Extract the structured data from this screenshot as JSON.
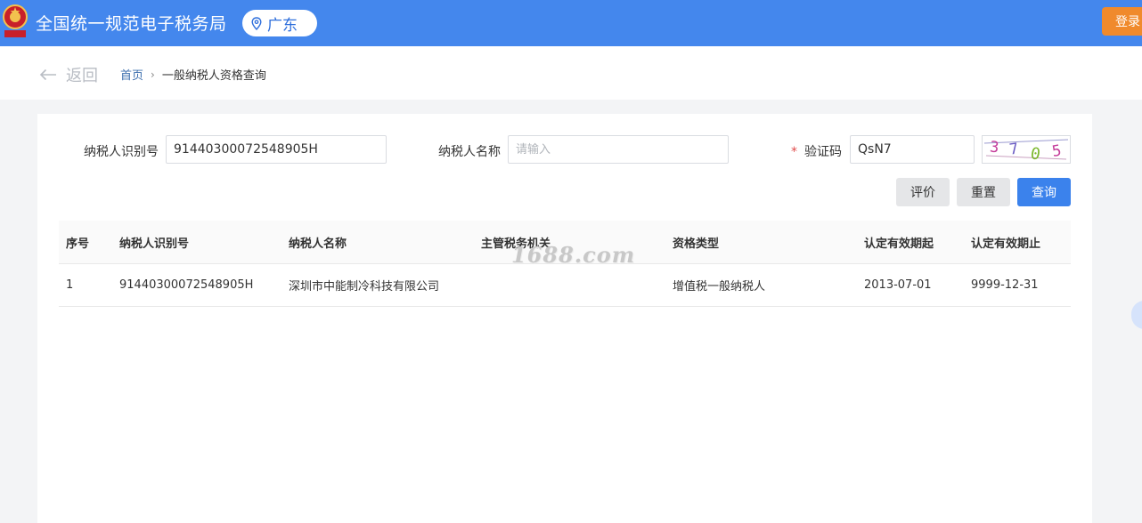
{
  "header": {
    "title": "全国统一规范电子税务局",
    "region": "广东",
    "login_label": "登录"
  },
  "subbar": {
    "back_label": "返回",
    "breadcrumb": [
      "首页",
      "一般纳税人资格查询"
    ]
  },
  "form": {
    "taxpayer_id_label": "纳税人识别号",
    "taxpayer_id_value": "91440300072548905H",
    "taxpayer_name_label": "纳税人名称",
    "taxpayer_name_placeholder": "请输入",
    "captcha_required_mark": "*",
    "captcha_label": "验证码",
    "captcha_value": "QsN7",
    "captcha_image_text": "3705"
  },
  "actions": {
    "evaluate_label": "评价",
    "reset_label": "重置",
    "query_label": "查询"
  },
  "table": {
    "columns": [
      "序号",
      "纳税人识别号",
      "纳税人名称",
      "主管税务机关",
      "资格类型",
      "认定有效期起",
      "认定有效期止"
    ],
    "rows": [
      [
        "1",
        "91440300072548905H",
        "深圳市中能制冷科技有限公司",
        "",
        "增值税一般纳税人",
        "2013-07-01",
        "9999-12-31"
      ]
    ]
  },
  "watermark": "1688.com",
  "colors": {
    "header_bg": "#4487ed",
    "login_bg": "#f08a2c",
    "primary_button": "#3b82ec",
    "required_mark": "#e04b4b"
  }
}
